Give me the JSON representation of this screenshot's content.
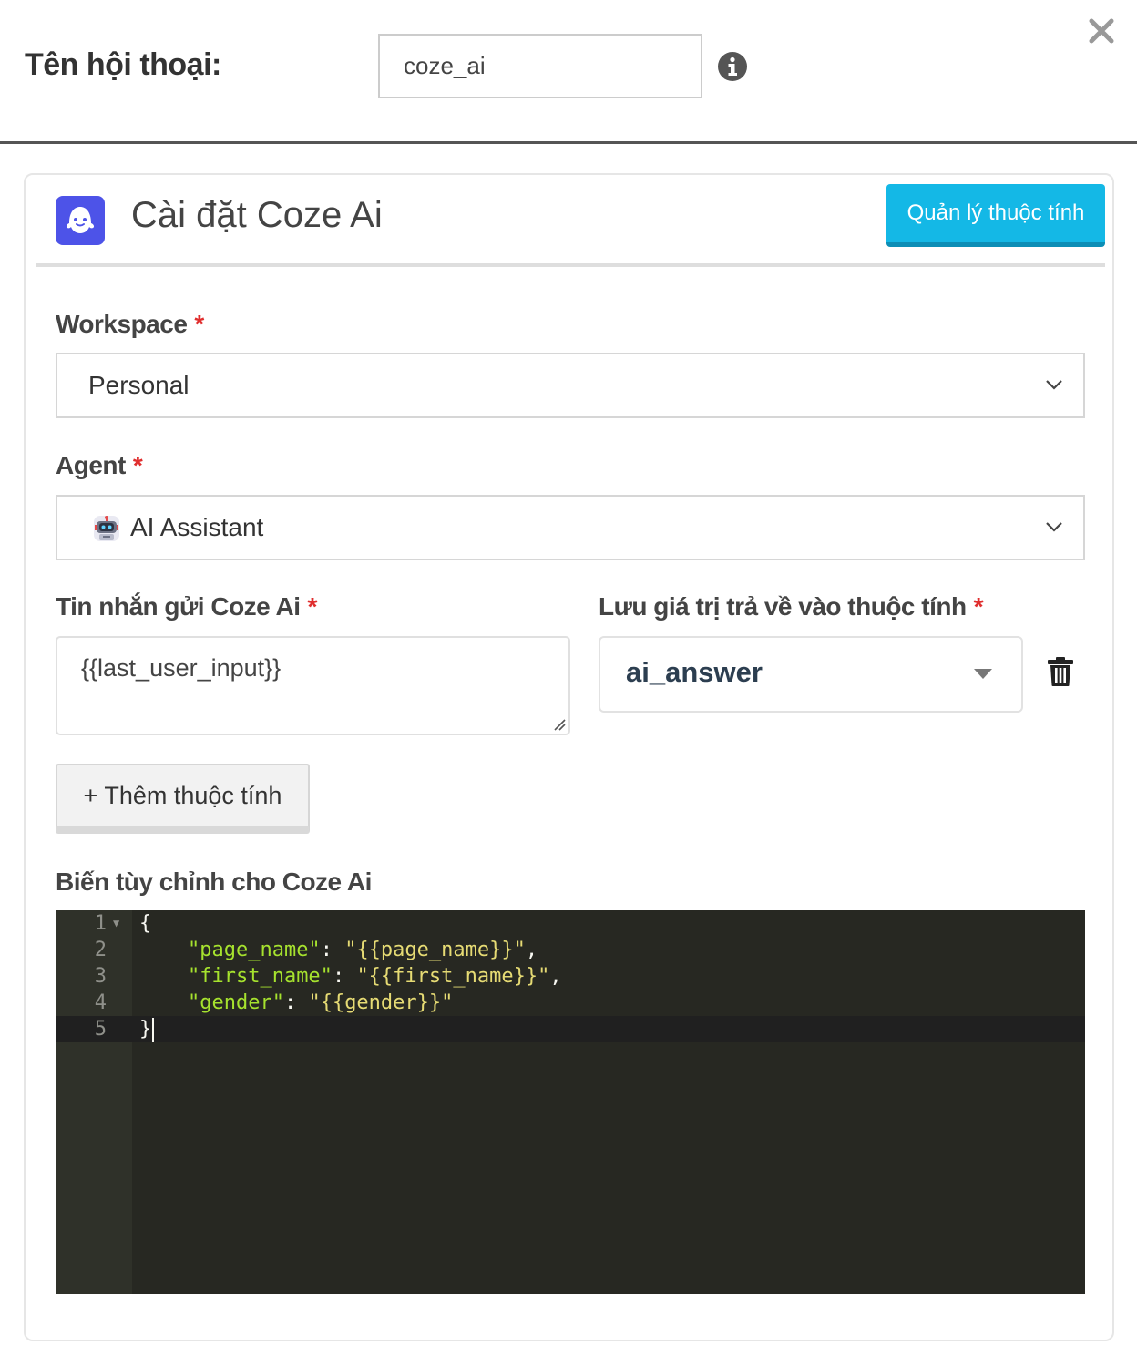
{
  "header": {
    "label": "Tên hội thoại:",
    "name_value": "coze_ai"
  },
  "card": {
    "title": "Cài đặt Coze Ai",
    "manage_button": "Quản lý thuộc tính"
  },
  "workspace": {
    "label": "Workspace",
    "required": "*",
    "value": "Personal"
  },
  "agent": {
    "label": "Agent",
    "required": "*",
    "value": "AI Assistant"
  },
  "message": {
    "label": "Tin nhắn gửi Coze Ai",
    "required": "*",
    "value": "{{last_user_input}}"
  },
  "save_to": {
    "label": "Lưu giá trị trả về vào thuộc tính",
    "required": "*",
    "value": "ai_answer"
  },
  "add_attribute_button": "+ Thêm thuộc tính",
  "custom_vars": {
    "label": "Biến tùy chỉnh cho Coze Ai",
    "lines": [
      {
        "n": "1",
        "open": "{"
      },
      {
        "n": "2",
        "key": "\"page_name\"",
        "sep": ": ",
        "val": "\"{{page_name}}\"",
        "end": ","
      },
      {
        "n": "3",
        "key": "\"first_name\"",
        "sep": ": ",
        "val": "\"{{first_name}}\"",
        "end": ","
      },
      {
        "n": "4",
        "key": "\"gender\"",
        "sep": ": ",
        "val": "\"{{gender}}\"",
        "end": ""
      },
      {
        "n": "5",
        "close": "}"
      }
    ]
  },
  "colors": {
    "accent": "#14b8e6",
    "required": "#e02e2e",
    "editor_bg": "#272822",
    "code_key": "#a6e22e",
    "code_string": "#e6db74",
    "coze_brand": "#4d53e8"
  }
}
